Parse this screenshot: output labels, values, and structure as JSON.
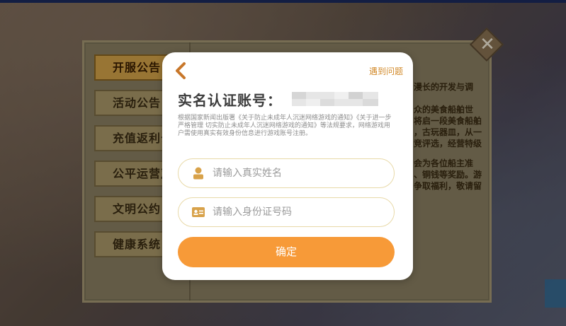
{
  "panel": {
    "tabs": [
      {
        "label": "开服公告",
        "active": true
      },
      {
        "label": "活动公告",
        "active": false
      },
      {
        "label": "充值返利公告",
        "active": false
      },
      {
        "label": "公平运营声明",
        "active": false
      },
      {
        "label": "文明公约",
        "active": false
      },
      {
        "label": "健康系统",
        "active": false
      }
    ],
    "content_lines": [
      "漫长的开发与调",
      "",
      "众的美食船舶世",
      "将启一段美食船舶",
      "，古玩器皿，从一",
      "竞评选，经营特级",
      "",
      "会为各位船主准",
      "、铜钱等奖励。游",
      "争取福利，敬请留"
    ],
    "close_symbol": "✕"
  },
  "modal": {
    "help_link": "遇到问题",
    "title": "实名认证账号：",
    "account_masked": true,
    "notice": "根据国家新闻出版署《关于防止未成年人沉迷网络游戏的通知》《关于进一步严格管理 切实防止未成年人沉迷网络游戏的通知》等法规要求，网络游戏用户需使用真实有效身份信息进行游戏账号注册。",
    "name_field": {
      "placeholder": "请输入真实姓名",
      "value": "",
      "icon": "person-icon"
    },
    "id_field": {
      "placeholder": "请输入身份证号码",
      "value": "",
      "icon": "id-card-icon"
    },
    "confirm_label": "确定"
  },
  "colors": {
    "accent": "#f79a38",
    "link": "#d28a2a",
    "icon": "#d8a24a",
    "active_tab": "#d3a249"
  }
}
